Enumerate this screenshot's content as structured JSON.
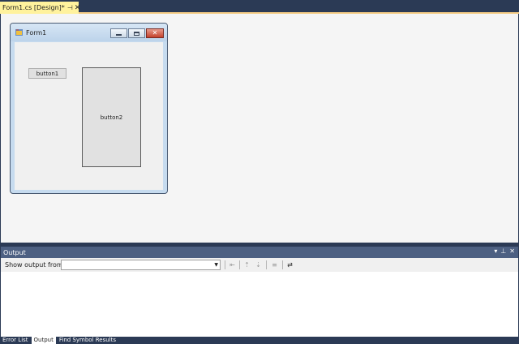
{
  "document_tab": {
    "title": "Form1.cs [Design]*",
    "pin_icon": "pin-icon",
    "close_icon": "close-icon"
  },
  "form": {
    "title": "Form1",
    "icon": "form-app-icon",
    "buttons": [
      {
        "label": "button1"
      },
      {
        "label": "button2"
      }
    ]
  },
  "output": {
    "title": "Output",
    "toolbar": {
      "show_output_from_label": "Show output from:",
      "source_value": ""
    }
  },
  "bottom_tabs": [
    {
      "label": "Error List",
      "active": false
    },
    {
      "label": "Output",
      "active": true
    },
    {
      "label": "Find Symbol Results",
      "active": false
    }
  ],
  "colors": {
    "ide_background": "#2b3a55",
    "active_tab": "#fff29d",
    "tool_window_title": "#4d6082",
    "designer_surface": "#f5f5f5",
    "form_client": "#f0f0f0",
    "button_face": "#e1e1e1"
  }
}
